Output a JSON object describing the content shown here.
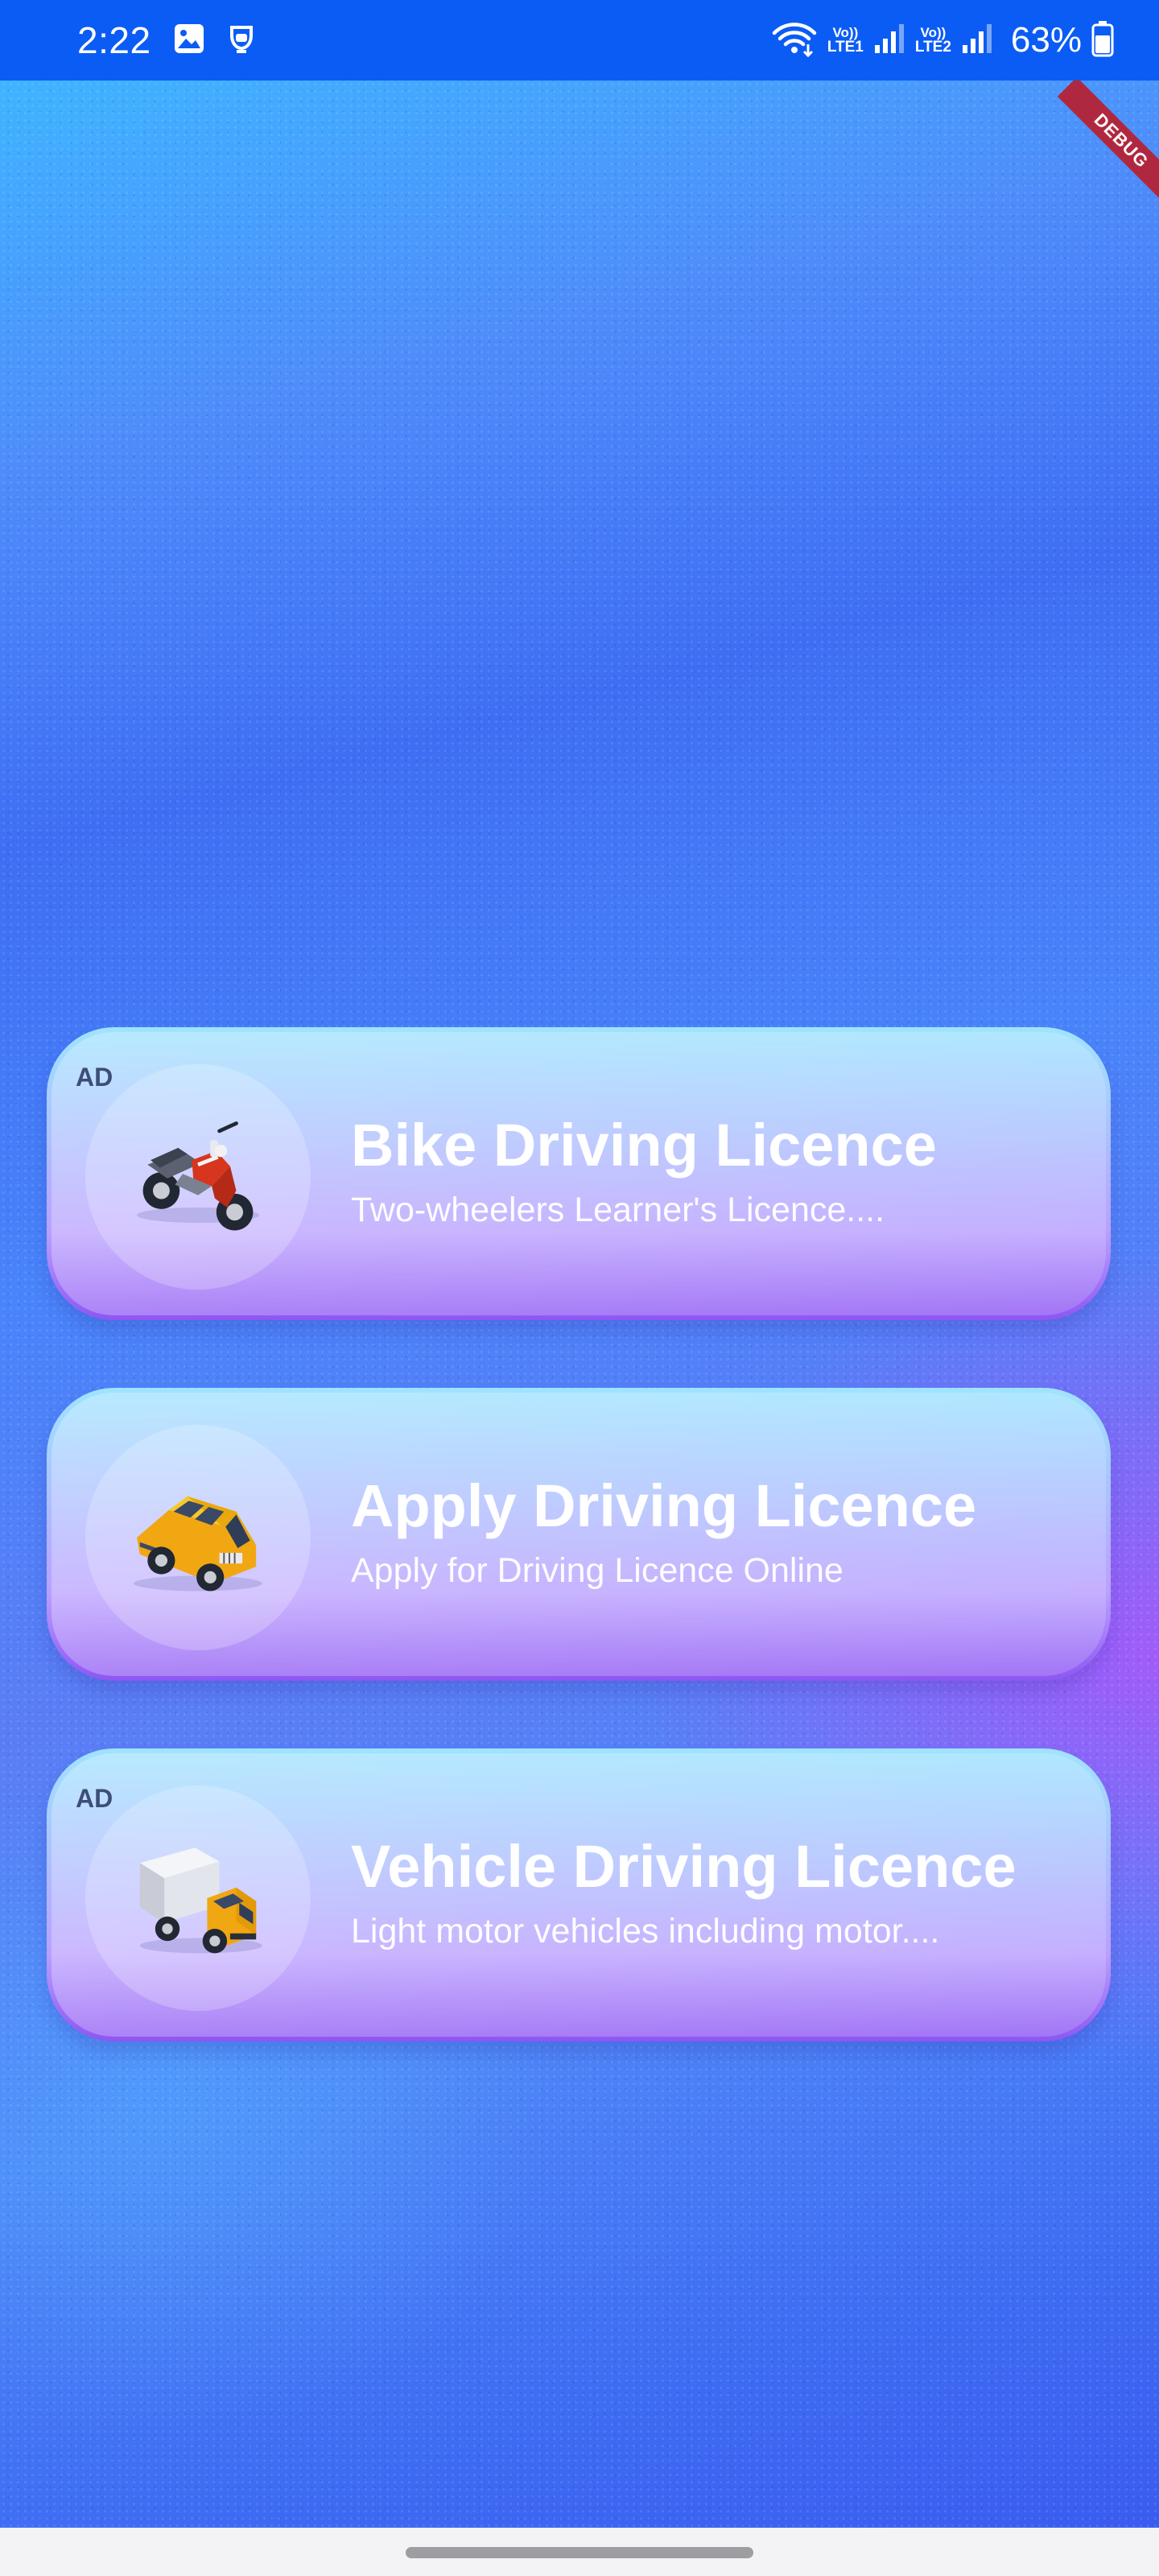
{
  "status_bar": {
    "time": "2:22",
    "sim1_top": "Vo))",
    "sim1_bottom": "LTE1",
    "sim2_top": "Vo))",
    "sim2_bottom": "LTE2",
    "battery": "63%",
    "icons": [
      "gallery-icon",
      "alarm-icon",
      "wifi-icon",
      "signal-icon",
      "signal-icon",
      "battery-icon"
    ]
  },
  "debug_banner": "DEBUG",
  "cards": [
    {
      "ad": "AD",
      "title": "Bike Driving Licence",
      "subtitle": "Two-wheelers Learner's Licence....",
      "icon": "motorcycle-icon"
    },
    {
      "title": "Apply Driving Licence",
      "subtitle": "Apply for Driving Licence Online",
      "icon": "car-icon"
    },
    {
      "ad": "AD",
      "title": "Vehicle Driving Licence",
      "subtitle": "Light motor vehicles including motor....",
      "icon": "truck-icon"
    }
  ],
  "colors": {
    "status_bar": "#0b5cf5",
    "background_top": "#3fb4ff",
    "background_mid": "#3f6ef4",
    "accent_purple": "#af55fa",
    "card_border_top": "#9fe4ff",
    "card_border_bottom": "#8e56f3",
    "text": "#ffffff"
  }
}
